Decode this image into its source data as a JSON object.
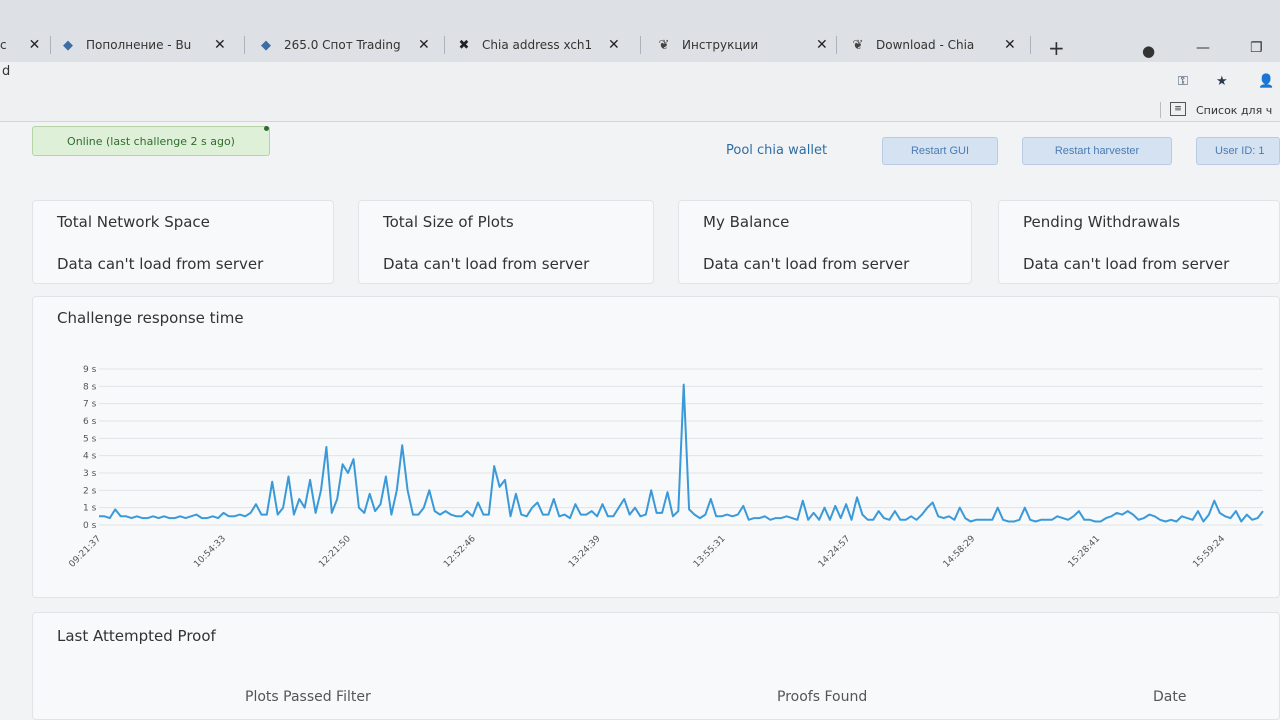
{
  "browser": {
    "tabs": [
      {
        "label": "Пополнение - Bu",
        "icon": "diamond-icon"
      },
      {
        "label": "265.0 Спот Trading",
        "icon": "diamond-icon"
      },
      {
        "label": "Chia address xch1",
        "icon": "x-logo-icon"
      },
      {
        "label": "Инструкции",
        "icon": "leaf-icon"
      },
      {
        "label": "Download - Chia",
        "icon": "leaf-icon"
      }
    ],
    "address_fragment": "d",
    "bookmarks_label": "Список для ч"
  },
  "status": {
    "text": "Online (last challenge 2 s ago)"
  },
  "toolbar": {
    "pool_link": "Pool chia wallet",
    "restart_gui": "Restart GUI",
    "restart_harvester": "Restart harvester",
    "user_id": "User ID: 1"
  },
  "cards": [
    {
      "title": "Total Network Space",
      "value": "Data can't load from server"
    },
    {
      "title": "Total Size of Plots",
      "value": "Data can't load from server"
    },
    {
      "title": "My Balance",
      "value": "Data can't load from server"
    },
    {
      "title": "Pending Withdrawals",
      "value": "Data can't load from server"
    }
  ],
  "chart_title": "Challenge response time",
  "proof": {
    "title": "Last Attempted Proof",
    "col_plots": "Plots Passed Filter",
    "col_proofs": "Proofs Found",
    "col_date": "Date"
  },
  "chart_data": {
    "type": "line",
    "color": "#3a9ad9",
    "ylim": [
      0,
      9
    ],
    "y_ticks": [
      "0 s",
      "1 s",
      "2 s",
      "3 s",
      "4 s",
      "5 s",
      "6 s",
      "7 s",
      "8 s",
      "9 s"
    ],
    "x_ticks": [
      "09:21:37",
      "10:54:33",
      "12:21:50",
      "12:52:46",
      "13:24:39",
      "13:55:31",
      "14:24:57",
      "14:58:29",
      "15:28:41",
      "15:59:24"
    ],
    "series": [
      {
        "values": [
          0.5,
          0.5,
          0.4,
          0.9,
          0.5,
          0.5,
          0.4,
          0.5,
          0.4,
          0.4,
          0.5,
          0.4,
          0.5,
          0.4,
          0.4,
          0.5,
          0.4,
          0.5,
          0.6,
          0.4,
          0.4,
          0.5,
          0.4,
          0.7,
          0.5,
          0.5,
          0.6,
          0.5,
          0.7,
          1.2,
          0.6,
          0.6,
          2.5,
          0.6,
          1.0,
          2.8,
          0.6,
          1.5,
          1.0,
          2.6,
          0.7,
          2.0,
          4.5,
          0.7,
          1.5,
          3.5,
          3.0,
          3.8,
          1.0,
          0.7,
          1.8,
          0.8,
          1.2,
          2.8,
          0.6,
          2.0,
          4.6,
          2.0,
          0.6,
          0.6,
          1.0,
          2.0,
          0.8,
          0.6,
          0.8,
          0.6,
          0.5,
          0.5,
          0.8,
          0.5,
          1.3,
          0.6,
          0.6,
          3.4,
          2.2,
          2.6,
          0.5,
          1.8,
          0.6,
          0.5,
          1.0,
          1.3,
          0.6,
          0.6,
          1.5,
          0.5,
          0.6,
          0.4,
          1.2,
          0.6,
          0.6,
          0.8,
          0.5,
          1.2,
          0.5,
          0.5,
          1.0,
          1.5,
          0.6,
          1.0,
          0.5,
          0.6,
          2.0,
          0.7,
          0.7,
          1.9,
          0.5,
          0.8,
          8.1,
          0.9,
          0.6,
          0.4,
          0.6,
          1.5,
          0.5,
          0.5,
          0.6,
          0.5,
          0.6,
          1.1,
          0.3,
          0.4,
          0.4,
          0.5,
          0.3,
          0.4,
          0.4,
          0.5,
          0.4,
          0.3,
          1.4,
          0.3,
          0.7,
          0.3,
          1.0,
          0.3,
          1.1,
          0.4,
          1.2,
          0.3,
          1.6,
          0.6,
          0.3,
          0.3,
          0.8,
          0.4,
          0.3,
          0.8,
          0.3,
          0.3,
          0.5,
          0.3,
          0.6,
          1.0,
          1.3,
          0.5,
          0.4,
          0.5,
          0.3,
          1.0,
          0.4,
          0.2,
          0.3,
          0.3,
          0.3,
          0.3,
          1.0,
          0.3,
          0.2,
          0.2,
          0.3,
          1.0,
          0.3,
          0.2,
          0.3,
          0.3,
          0.3,
          0.5,
          0.4,
          0.3,
          0.5,
          0.8,
          0.3,
          0.3,
          0.2,
          0.2,
          0.4,
          0.5,
          0.7,
          0.6,
          0.8,
          0.6,
          0.3,
          0.4,
          0.6,
          0.5,
          0.3,
          0.2,
          0.3,
          0.2,
          0.5,
          0.4,
          0.3,
          0.8,
          0.2,
          0.6,
          1.4,
          0.7,
          0.5,
          0.4,
          0.8,
          0.2,
          0.6,
          0.3,
          0.4,
          0.8
        ]
      }
    ]
  }
}
